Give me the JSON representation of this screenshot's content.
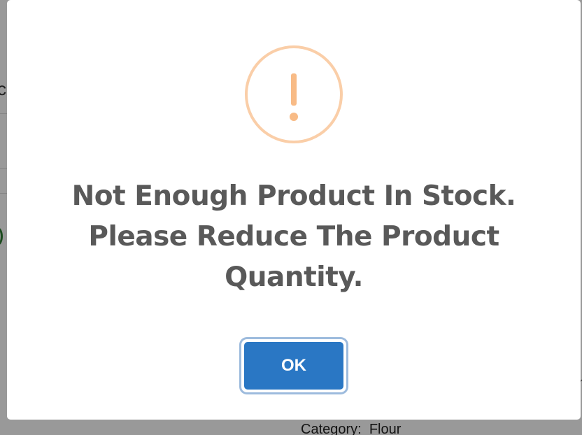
{
  "background": {
    "fragment_text": "c",
    "category_text": "Category:  Flour"
  },
  "modal": {
    "icon": "warning-exclamation-icon",
    "title_line1": "Not Enough Product In Stock.",
    "title_line2": "Please Reduce The Product",
    "title_line3": "Quantity.",
    "confirm_label": "OK"
  },
  "colors": {
    "overlay": "rgba(0,0,0,0.4)",
    "icon_border": "#facea8",
    "icon_mark": "#f8bb86",
    "title_text": "#595959",
    "button": "#2a77c4",
    "button_focus_ring": "#9dbbdd"
  }
}
